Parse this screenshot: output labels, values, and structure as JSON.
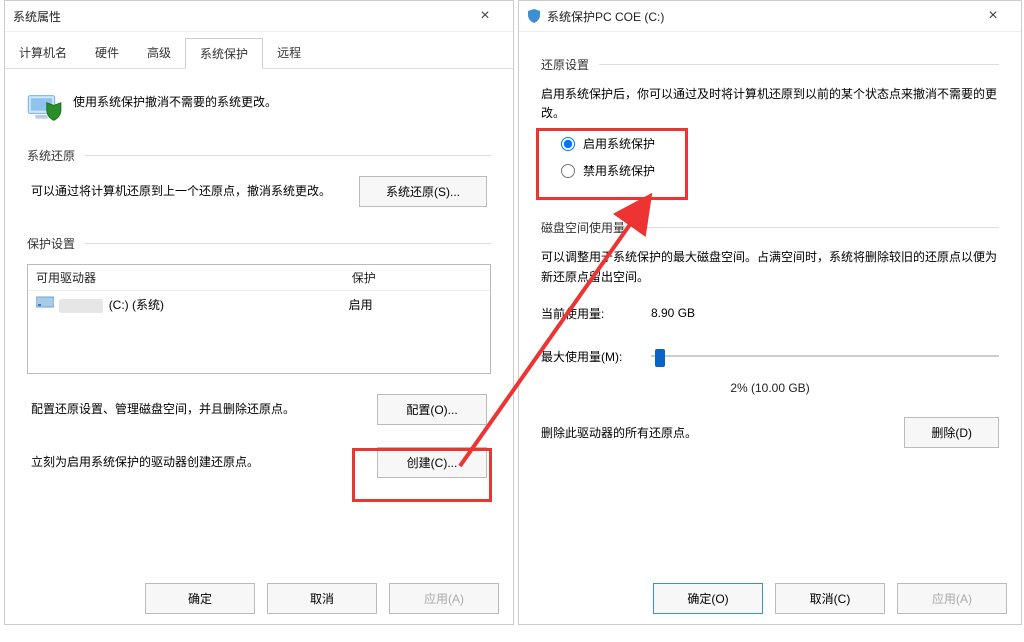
{
  "left": {
    "title": "系统属性",
    "tabs": [
      "计算机名",
      "硬件",
      "高级",
      "系统保护",
      "远程"
    ],
    "active_tab_index": 3,
    "intro": "使用系统保护撤消不需要的系统更改。",
    "sections": {
      "restore": {
        "header": "系统还原",
        "text": "可以通过将计算机还原到上一个还原点，撤消系统更改。",
        "button": "系统还原(S)..."
      },
      "protect": {
        "header": "保护设置",
        "columns": {
          "drive": "可用驱动器",
          "protection": "保护"
        },
        "row": {
          "drive_suffix": "(C:) (系统)",
          "protection": "启用"
        },
        "config_text": "配置还原设置、管理磁盘空间，并且删除还原点。",
        "config_button": "配置(O)...",
        "create_text": "立刻为启用系统保护的驱动器创建还原点。",
        "create_button": "创建(C)..."
      }
    },
    "footer": {
      "ok": "确定",
      "cancel": "取消",
      "apply": "应用(A)"
    }
  },
  "right": {
    "title": "系统保护PC COE (C:)",
    "sections": {
      "restore": {
        "header": "还原设置",
        "desc": "启用系统保护后，你可以通过及时将计算机还原到以前的某个状态点来撤消不需要的更改。",
        "radio_on": "启用系统保护",
        "radio_off": "禁用系统保护",
        "selected": "on"
      },
      "disk": {
        "header": "磁盘空间使用量",
        "desc": "可以调整用于系统保护的最大磁盘空间。占满空间时，系统将删除较旧的还原点以便为新还原点留出空间。",
        "current_label": "当前使用量:",
        "current_value": "8.90 GB",
        "max_label": "最大使用量(M):",
        "slider_percent": 2,
        "usage_text": "2% (10.00 GB)",
        "delete_text": "删除此驱动器的所有还原点。",
        "delete_button": "删除(D)"
      }
    },
    "footer": {
      "ok": "确定(O)",
      "cancel": "取消(C)",
      "apply": "应用(A)"
    }
  }
}
